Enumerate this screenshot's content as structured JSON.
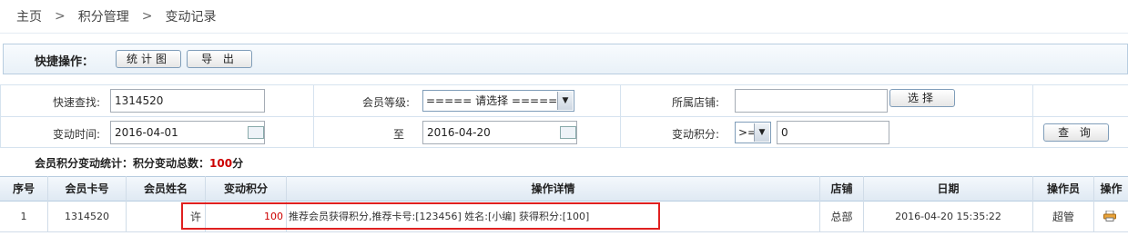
{
  "breadcrumb": [
    "主页",
    "积分管理",
    "变动记录"
  ],
  "breadcrumb_sep": ">",
  "quick_ops": {
    "label": "快捷操作：",
    "stats_button": "统计图",
    "export_button": "导 出"
  },
  "form": {
    "quick_search_label": "快速查找:",
    "quick_search_value": "1314520",
    "member_level_label": "会员等级:",
    "member_level_value": "===== 请选择 =====",
    "store_label": "所属店铺:",
    "store_value": "",
    "select_button": "选择",
    "change_time_label": "变动时间:",
    "date_from": "2016-04-01",
    "to_label": "至",
    "date_to": "2016-04-20",
    "points_label": "变动积分:",
    "operator_value": ">=",
    "points_value": "0",
    "query_button": "查 询"
  },
  "stats": {
    "prefix": "会员积分变动统计：积分变动总数：",
    "total": "100",
    "unit": "分"
  },
  "table": {
    "headers": [
      "序号",
      "会员卡号",
      "会员姓名",
      "变动积分",
      "操作详情",
      "店铺",
      "日期",
      "操作员",
      "操作"
    ],
    "rows": [
      {
        "index": "1",
        "card": "1314520",
        "name": "许",
        "points": "100",
        "detail": "推荐会员获得积分,推荐卡号:[123456] 姓名:[小编] 获得积分:[100]",
        "store": "总部",
        "date": "2016-04-20 15:35:22",
        "operator": "超管",
        "action_icon": "print-icon"
      }
    ]
  },
  "colors": {
    "accent_red": "#cc0000",
    "highlight_border": "#e02020",
    "header_border": "#b8cde0"
  }
}
